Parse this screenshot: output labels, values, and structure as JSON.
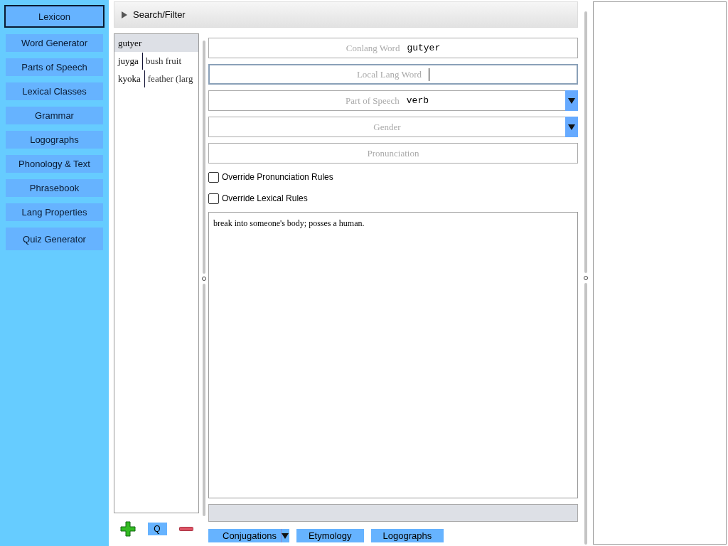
{
  "sidebar": {
    "items": [
      {
        "label": "Lexicon",
        "selected": true
      },
      {
        "label": "Word Generator",
        "selected": false
      },
      {
        "label": "Parts of Speech",
        "selected": false
      },
      {
        "label": "Lexical Classes",
        "selected": false
      },
      {
        "label": "Grammar",
        "selected": false
      },
      {
        "label": "Logographs",
        "selected": false
      },
      {
        "label": "Phonology & Text",
        "selected": false
      },
      {
        "label": "Phrasebook",
        "selected": false
      },
      {
        "label": "Lang Properties",
        "selected": false
      },
      {
        "label": "Quiz Generator",
        "selected": false
      }
    ]
  },
  "search_filter": {
    "label": "Search/Filter",
    "expanded": false
  },
  "word_list": {
    "items": [
      {
        "word": "gutyer",
        "selected": true
      },
      {
        "word": "juyga",
        "gloss": "bush fruit",
        "selected": false
      },
      {
        "word": "kyoka",
        "gloss": "feather (larg",
        "selected": false
      }
    ]
  },
  "list_buttons": [
    {
      "kind": "add"
    },
    {
      "kind": "text",
      "label": "Q"
    },
    {
      "kind": "remove"
    }
  ],
  "form": {
    "fields": [
      {
        "kind": "text",
        "label": "Conlang Word",
        "value": "gutyer",
        "focused": false
      },
      {
        "kind": "text",
        "placeholder": "Local Lang Word",
        "focused": true
      },
      {
        "kind": "select",
        "label": "Part of Speech",
        "value": "verb",
        "focused": false
      },
      {
        "kind": "select",
        "placeholder": "Gender",
        "focused": false
      },
      {
        "kind": "text",
        "placeholder": "Pronunciation",
        "focused": false
      }
    ],
    "checkboxes": [
      {
        "label": "Override Pronunciation Rules",
        "checked": false
      },
      {
        "label": "Override Lexical Rules",
        "checked": false
      }
    ],
    "definition": "break into someone's body; posses a human.",
    "buttons": [
      {
        "label": "Conjugations",
        "dropdown": true
      },
      {
        "label": "Etymology",
        "dropdown": false
      },
      {
        "label": "Logographs",
        "dropdown": false
      }
    ]
  }
}
